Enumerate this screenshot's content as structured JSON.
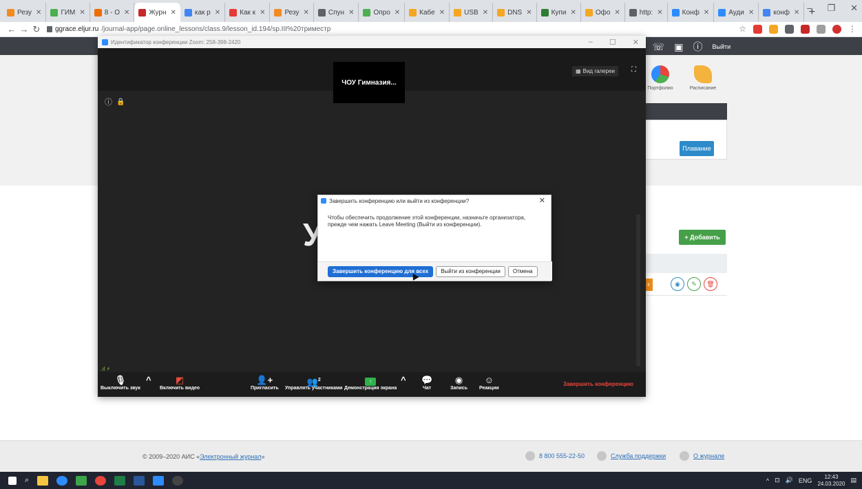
{
  "browser": {
    "tabs": [
      {
        "label": "Резу",
        "color": "#f28b22"
      },
      {
        "label": "ГИМ",
        "color": "#4caf50"
      },
      {
        "label": "8 - О",
        "color": "#ef6c00"
      },
      {
        "label": "Журн",
        "color": "#c62828",
        "active": true
      },
      {
        "label": "как р",
        "color": "#4285f4"
      },
      {
        "label": "Как к",
        "color": "#e53935"
      },
      {
        "label": "Резу",
        "color": "#f28b22"
      },
      {
        "label": "Спун",
        "color": "#5f6368"
      },
      {
        "label": "Опро",
        "color": "#4caf50"
      },
      {
        "label": "Кабе",
        "color": "#f5a623"
      },
      {
        "label": "USB ",
        "color": "#f5a623"
      },
      {
        "label": "DNS",
        "color": "#f5a623"
      },
      {
        "label": "Купи",
        "color": "#2e7d32"
      },
      {
        "label": "Офо",
        "color": "#f5a623"
      },
      {
        "label": "http:",
        "color": "#5f6368"
      },
      {
        "label": "Конф",
        "color": "#2d8cff"
      },
      {
        "label": "Ауди",
        "color": "#2d8cff"
      },
      {
        "label": "конф",
        "color": "#4285f4"
      }
    ],
    "url_host": "ggrace.eljur.ru",
    "url_path": "/journal-app/page.online_lessons/class.9/lesson_id.194/sp.III%20триместр"
  },
  "site": {
    "logout": "Выйти",
    "portal_items": [
      {
        "label": "Портфолио",
        "color": "#e8453c"
      },
      {
        "label": "Расписание",
        "color": "#f3b33d"
      }
    ],
    "swim_button": "Плавание",
    "add_button": "+ Добавить",
    "footer": {
      "copyright": "© 2009–2020 АИС «",
      "copyright_link": "Электронный журнал",
      "copyright_end": "»",
      "phone": "8 800 555-22-50",
      "support": "Служба поддержки",
      "about": "О журнале"
    }
  },
  "zoom": {
    "window_title": "Идентификатор конференции Zoom: 258-398-2420",
    "participant_tile": "ЧОУ Гимназия...",
    "gallery_view": "Вид галереи",
    "big_initial": "У",
    "toolbar": {
      "mute": "Выключить звук",
      "video": "Включить видео",
      "invite": "Пригласить",
      "manage": "Управлять участниками",
      "participants_count": "2",
      "share": "Демонстрация экрана",
      "chat": "Чат",
      "record": "Запись",
      "reactions": "Реакции",
      "end": "Завершить конференцию"
    },
    "dialog": {
      "title": "Завершить конференцию или выйти из конференции?",
      "body": "Чтобы обеспечить продолжение этой конференции, назначьте организатора, прежде чем нажать Leave Meeting (Выйти из конференции).",
      "end_all": "Завершить конференцию для всех",
      "leave": "Выйти из конференции",
      "cancel": "Отмена"
    }
  },
  "taskbar": {
    "lang": "ENG",
    "time": "12:43",
    "date": "24.03.2020"
  }
}
